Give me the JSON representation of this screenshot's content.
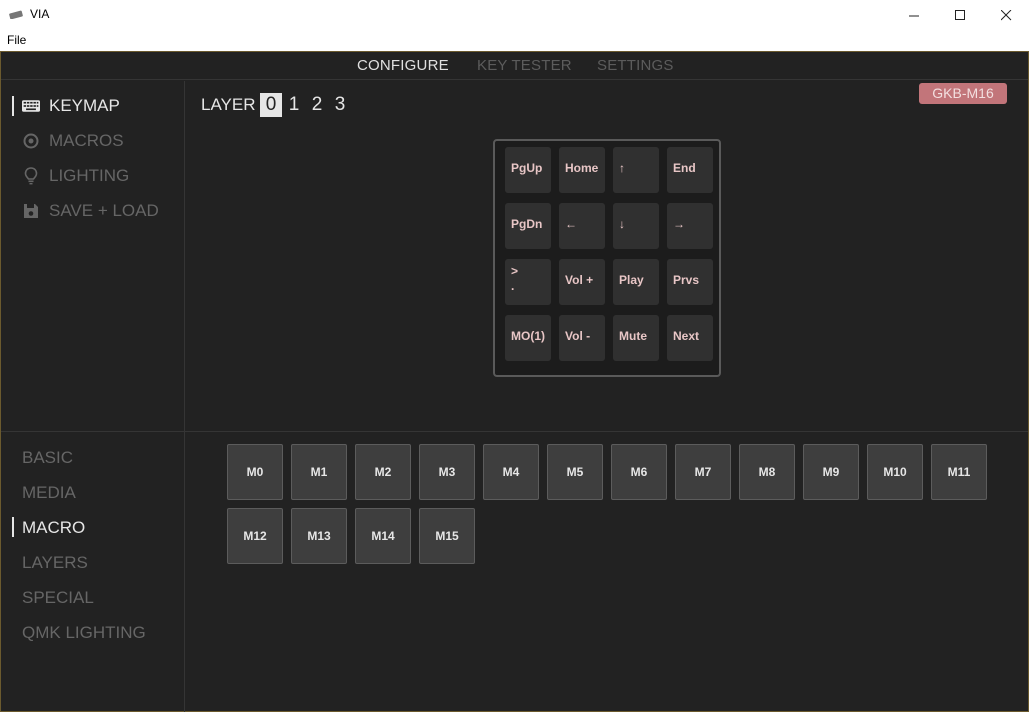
{
  "window": {
    "title": "VIA"
  },
  "menubar": {
    "file": "File"
  },
  "topnav": {
    "tabs": [
      {
        "label": "CONFIGURE",
        "active": true
      },
      {
        "label": "KEY TESTER",
        "active": false
      },
      {
        "label": "SETTINGS",
        "active": false
      }
    ]
  },
  "sidebar": {
    "items": [
      {
        "label": "KEYMAP",
        "icon": "keyboard-icon",
        "active": true
      },
      {
        "label": "MACROS",
        "icon": "macro-circle-icon",
        "active": false
      },
      {
        "label": "LIGHTING",
        "icon": "lightbulb-icon",
        "active": false
      },
      {
        "label": "SAVE + LOAD",
        "icon": "floppy-disk-icon",
        "active": false
      }
    ]
  },
  "keymap": {
    "layer_label": "LAYER",
    "layers": [
      "0",
      "1",
      "2",
      "3"
    ],
    "active_layer": "0",
    "keyboard_name": "GKB-M16",
    "keys": [
      [
        "PgUp",
        "Home",
        "↑",
        "End"
      ],
      [
        "PgDn",
        "←",
        "↓",
        "→"
      ],
      [
        ">\n.",
        "Vol +",
        "Play",
        "Prvs"
      ],
      [
        "MO(1)",
        "Vol -",
        "Mute",
        "Next"
      ]
    ]
  },
  "categories": {
    "items": [
      {
        "label": "BASIC",
        "active": false
      },
      {
        "label": "MEDIA",
        "active": false
      },
      {
        "label": "MACRO",
        "active": true
      },
      {
        "label": "LAYERS",
        "active": false
      },
      {
        "label": "SPECIAL",
        "active": false
      },
      {
        "label": "QMK LIGHTING",
        "active": false
      }
    ]
  },
  "macro_keys": [
    "M0",
    "M1",
    "M2",
    "M3",
    "M4",
    "M5",
    "M6",
    "M7",
    "M8",
    "M9",
    "M10",
    "M11",
    "M12",
    "M13",
    "M14",
    "M15"
  ],
  "colors": {
    "background": "#222222",
    "badge": "#c2757a",
    "key_legend": "#e8c6c6",
    "active_text": "#e6e6e6",
    "inactive_text": "#666666"
  }
}
